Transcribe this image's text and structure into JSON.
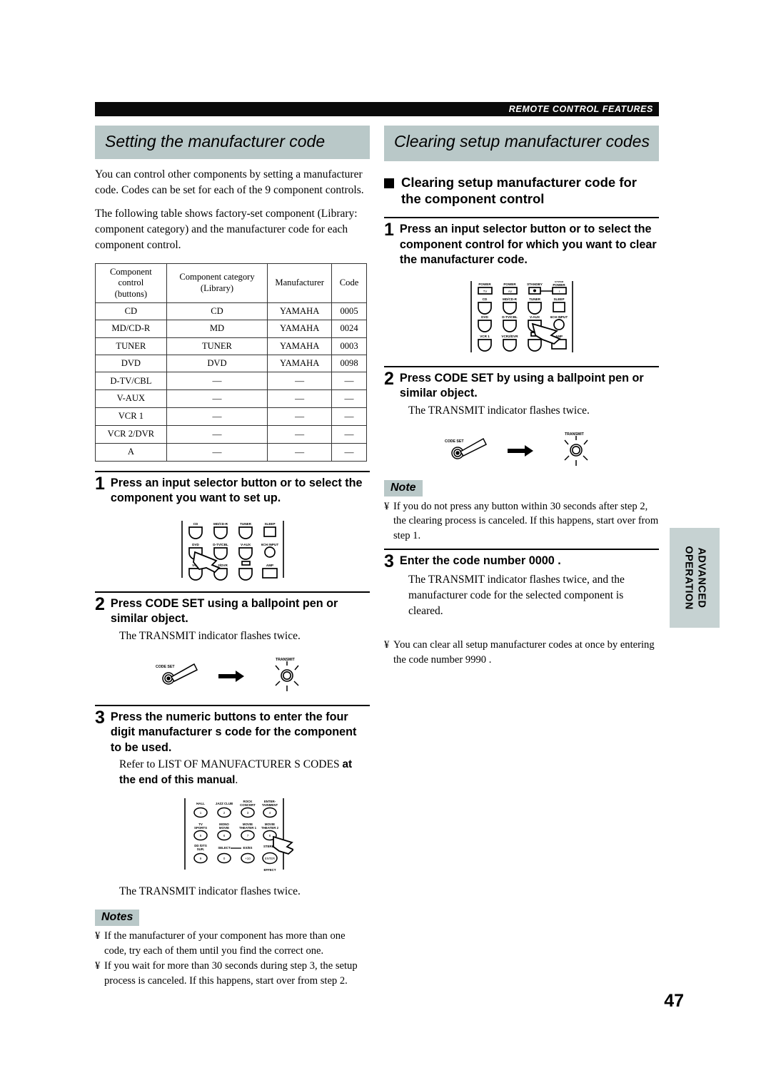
{
  "header": {
    "running_head": "REMOTE CONTROL FEATURES"
  },
  "page_number": "47",
  "side_tab": {
    "label": "ADVANCED\nOPERATION",
    "line1": "ADVANCED",
    "line2": "OPERATION",
    "bg_color": "#c6d2d2"
  },
  "colors": {
    "banner_bg": "#b9c8c8",
    "topbar_bg": "#0a0a0a",
    "text": "#000000"
  },
  "left_column": {
    "banner_title": "Setting the manufacturer code",
    "intro_paragraph_1": "You can control other components by setting a manufacturer code. Codes can be set for each of the 9 component controls.",
    "intro_paragraph_2": "The following table shows factory-set component (Library: component category) and the manufacturer code for each component control.",
    "table": {
      "headers": [
        "Component control (buttons)",
        "Component category (Library)",
        "Manufacturer",
        "Code"
      ],
      "header_lines": {
        "col1": [
          "Component",
          "control",
          "(buttons)"
        ],
        "col2": [
          "Component category",
          "(Library)"
        ],
        "col3": [
          "Manufacturer"
        ],
        "col4": [
          "Code"
        ]
      },
      "rows": [
        {
          "control": "CD",
          "category": "CD",
          "manufacturer": "YAMAHA",
          "code": "0005"
        },
        {
          "control": "MD/CD-R",
          "category": "MD",
          "manufacturer": "YAMAHA",
          "code": "0024"
        },
        {
          "control": "TUNER",
          "category": "TUNER",
          "manufacturer": "YAMAHA",
          "code": "0003"
        },
        {
          "control": "DVD",
          "category": "DVD",
          "manufacturer": "YAMAHA",
          "code": "0098"
        },
        {
          "control": "D-TV/CBL",
          "category": "—",
          "manufacturer": "—",
          "code": "—"
        },
        {
          "control": "V-AUX",
          "category": "—",
          "manufacturer": "—",
          "code": "—"
        },
        {
          "control": "VCR 1",
          "category": "—",
          "manufacturer": "—",
          "code": "—"
        },
        {
          "control": "VCR 2/DVR",
          "category": "—",
          "manufacturer": "—",
          "code": "—"
        },
        {
          "control": "A",
          "category": "—",
          "manufacturer": "—",
          "code": "—"
        }
      ]
    },
    "steps": [
      {
        "number": "1",
        "title": "Press an input selector button or     to select the component you want to set up.",
        "sub": ""
      },
      {
        "number": "2",
        "title": "Press CODE SET using a ballpoint pen or similar object.",
        "sub": "The TRANSMIT indicator flashes twice."
      },
      {
        "number": "3",
        "title": "Press the numeric buttons to enter the four digit manufacturer s code for the component to be used.",
        "sub_plain": "Refer to  LIST OF MANUFACTURER S CODES ",
        "sub_bold": "at the end of this manual",
        "sub_tail": "."
      }
    ],
    "transmit_caption": "The TRANSMIT indicator flashes twice.",
    "notes_badge": "Notes",
    "notes": [
      "If the manufacturer of your component has more than one code, try each of them until you find the correct one.",
      "If you wait for more than 30 seconds during step 3, the setup process is canceled. If this happens, start over from step 2."
    ],
    "diagram_labels": {
      "selector_pad": [
        "CD",
        "MD/CD-R",
        "TUNER",
        "SLEEP",
        "DVD",
        "D-TV/CBL",
        "V-AUX",
        "6CH INPUT",
        "VCR",
        "2/DVR",
        "A",
        "AMP"
      ],
      "code_set": "CODE SET",
      "transmit": "TRANSMIT",
      "numeric_pad": [
        "HALL",
        "JAZZ CLUB",
        "ROCK CONCERT",
        "ENTER-TAINMENT",
        "TV SPORTS",
        "MONO MOVIE",
        "MOVIE THEATER 1",
        "MOVIE THEATER 2",
        "DD /DTS SUR.",
        "SELECT",
        "EX/ES",
        "STEREO",
        "ENTER",
        "EFFECT"
      ],
      "numeric_digits": [
        "1",
        "2",
        "3",
        "4",
        "5",
        "6",
        "7",
        "8",
        "9",
        "0",
        "+10"
      ]
    }
  },
  "right_column": {
    "banner_title": "Clearing setup manufacturer codes",
    "subheading": "Clearing setup manufacturer code for the component control",
    "steps": [
      {
        "number": "1",
        "title": "Press an input selector button or     to select the component control for which you want to clear the manufacturer code.",
        "sub": ""
      },
      {
        "number": "2",
        "title": "Press CODE SET by using a ballpoint pen or similar object.",
        "sub": "The TRANSMIT indicator flashes twice."
      },
      {
        "number": "3",
        "title": "Enter the code number  0000 .",
        "sub": "The TRANSMIT indicator flashes twice, and the manufacturer code for the selected component is cleared."
      }
    ],
    "note_badge": "Note",
    "note_items": [
      "If you do not press any button within 30 seconds after step 2, the clearing process is canceled. If this happens, start over from step 1."
    ],
    "trailing_notes": [
      "You can clear all setup manufacturer codes at once by entering the code number  9990 ."
    ],
    "diagram_labels": {
      "power_row": [
        "POWER",
        "POWER",
        "STANDBY",
        "SYSTEM POWER"
      ],
      "power_keys": [
        "TV",
        "AV",
        "",
        "I"
      ],
      "selector_pad": [
        "CD",
        "MD/CD-R",
        "TUNER",
        "SLEEP",
        "DVD",
        "D-TV/CBL",
        "V-AUX",
        "6CH INPUT",
        "VCR 1",
        "VCR2/DVR",
        "A",
        "AMP"
      ],
      "code_set": "CODE SET",
      "transmit": "TRANSMIT"
    }
  }
}
